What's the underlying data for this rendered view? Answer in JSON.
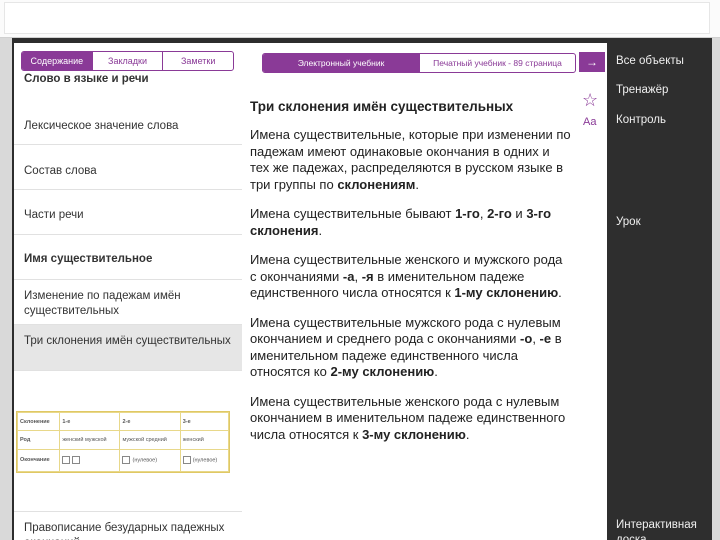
{
  "sidebar": {
    "tabs": [
      {
        "label": "Содержание",
        "active": true
      },
      {
        "label": "Закладки",
        "active": false
      },
      {
        "label": "Заметки",
        "active": false
      }
    ],
    "items": [
      {
        "label": "Слово в языке и речи"
      },
      {
        "label": "Лексическое значение слова"
      },
      {
        "label": "Состав слова"
      },
      {
        "label": "Части речи"
      },
      {
        "label": "Имя существительное"
      },
      {
        "label": "Изменение по падежам имён существительных"
      },
      {
        "label": "Три склонения имён существительных"
      },
      {
        "label": "Правописание безударных падежных окончаний"
      }
    ],
    "thumbnail_table": {
      "headers": [
        "Склонение",
        "1-е",
        "2-е",
        "3-е"
      ],
      "row_gender": {
        "label": "Род",
        "c1": "женский мужской",
        "c2": "мужской средний",
        "c3": "женский"
      },
      "row_ending": {
        "label": "Окончание",
        "c2": "(нулевое)",
        "c3": "(нулевое)"
      }
    }
  },
  "main": {
    "tabs": [
      {
        "label": "Электронный учебник",
        "active": true
      },
      {
        "label": "Печатный учебник - 89 страница",
        "active": false
      }
    ],
    "title": "Три склонения имён существительных",
    "paragraphs": [
      {
        "text": "Имена существительные, которые при изменении по падежам имеют одинаковые окончания в одних и тех же падежах, распределяются в русском языке в три группы по ",
        "bold": "склонениям",
        "tail": "."
      },
      {
        "p1": "Имена существительные бывают ",
        "b1": "1-го",
        "p2": ", ",
        "b2": "2-го",
        "p3": " и ",
        "b3": "3-го склонения",
        "p4": "."
      },
      {
        "text": "Имена существительные женского и мужского рода с окончаниями ",
        "b1": "-а",
        "p2": ", ",
        "b2": "-я",
        "p3": " в именительном падеже единственного числа относятся к ",
        "b3": "1-му склонению",
        "p4": "."
      },
      {
        "text": "Имена существительные мужского рода с нулевым окончанием и среднего рода с окончаниями ",
        "b1": "-о",
        "p2": ", ",
        "b2": "-е",
        "p3": " в именительном падеже единственного числа относятся ко ",
        "b3": "2-му склонению",
        "p4": "."
      },
      {
        "text": "Имена существительные женского рода с нулевым окончанием в именительном падеже единственного числа относятся к ",
        "b3": "3-му склонению",
        "p4": "."
      }
    ]
  },
  "tools": {
    "arrow": "→",
    "star_icon": "☆",
    "font_size_label": "Aa"
  },
  "rightpanel": {
    "items": [
      "Все объекты",
      "Тренажёр",
      "Контроль",
      "Урок",
      "Интерактивная доска"
    ]
  },
  "colors": {
    "accent": "#8a3a97",
    "dark_panel": "#2e2e2e"
  }
}
